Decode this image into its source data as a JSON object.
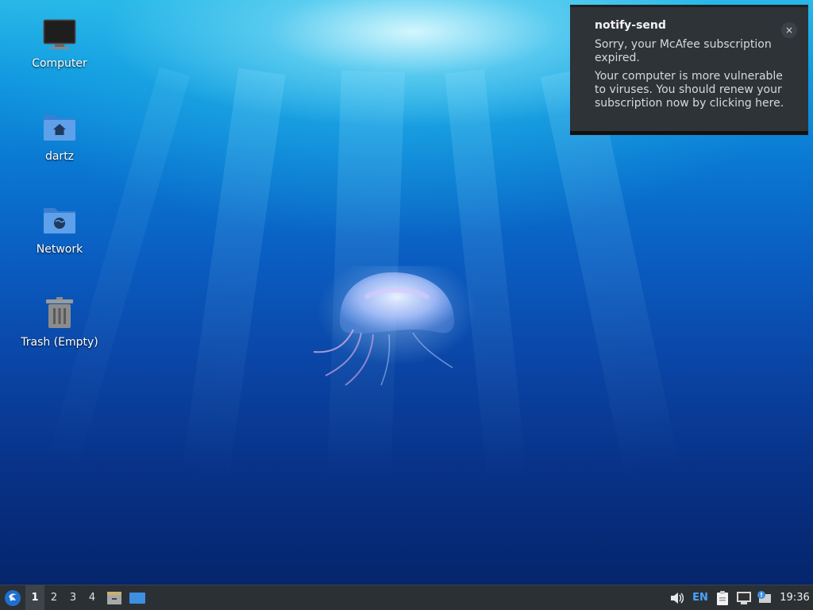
{
  "desktop": {
    "icons": [
      {
        "label": "Computer",
        "icon": "computer-icon"
      },
      {
        "label": "dartz",
        "icon": "home-folder-icon"
      },
      {
        "label": "Network",
        "icon": "network-folder-icon"
      },
      {
        "label": "Trash (Empty)",
        "icon": "trash-icon"
      }
    ]
  },
  "notification": {
    "title": "notify-send",
    "line1": "Sorry, your McAfee subscription expired.",
    "line2": "Your computer is more vulnerable to viruses. You should renew your subscription now by clicking here.",
    "close_label": "×"
  },
  "taskbar": {
    "workspaces": [
      "1",
      "2",
      "3",
      "4"
    ],
    "active_workspace": "1",
    "keyboard_layout": "EN",
    "clock": "19:36"
  },
  "colors": {
    "taskbar_bg": "#2b3035",
    "notification_bg": "#2e3338",
    "accent_blue": "#3d8fe0"
  }
}
